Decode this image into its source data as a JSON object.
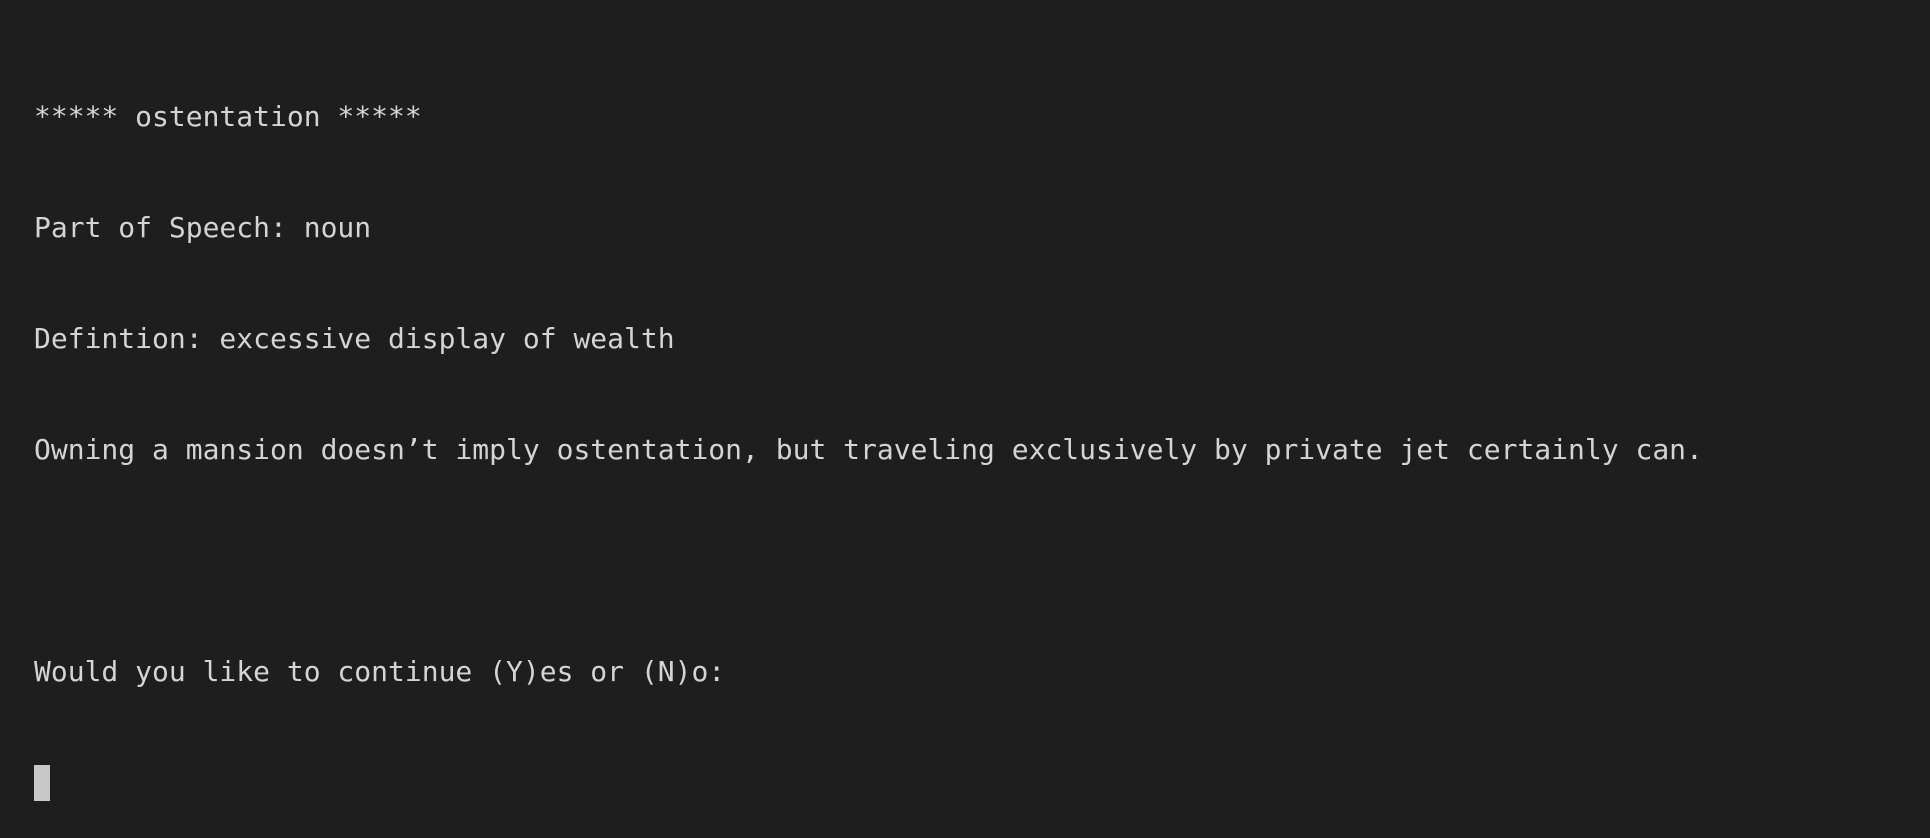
{
  "terminal": {
    "lines": [
      "***** ostentation *****",
      "Part of Speech: noun",
      "Defintion: excessive display of wealth",
      "Owning a mansion doesn’t imply ostentation, but traveling exclusively by private jet certainly can."
    ],
    "prompt": "Would you like to continue (Y)es or (N)o:"
  }
}
